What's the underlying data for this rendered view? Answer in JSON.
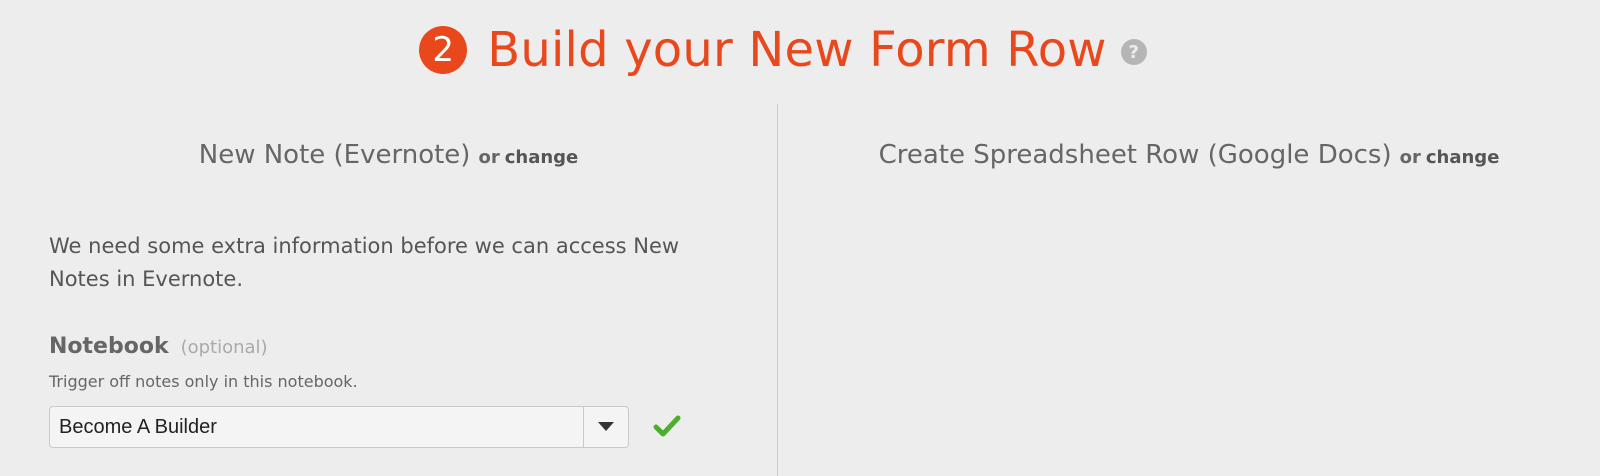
{
  "header": {
    "step_number": "2",
    "title": "Build your New Form Row",
    "help_icon": "question-circle-icon",
    "accent_color": "#e8481c"
  },
  "trigger": {
    "app_name": "New Note (Evernote)",
    "or_text": "or",
    "change_label": "change",
    "info_text": "We need some extra information before we can access New Notes in Evernote.",
    "field": {
      "label": "Notebook",
      "optional": "(optional)",
      "help": "Trigger off notes only in this notebook.",
      "value": "Become A Builder",
      "dropdown_icon": "caret-down-icon",
      "status_icon": "check-icon",
      "status_color": "#4caf2a"
    }
  },
  "action": {
    "app_name": "Create Spreadsheet Row (Google Docs)",
    "or_text": "or",
    "change_label": "change"
  }
}
